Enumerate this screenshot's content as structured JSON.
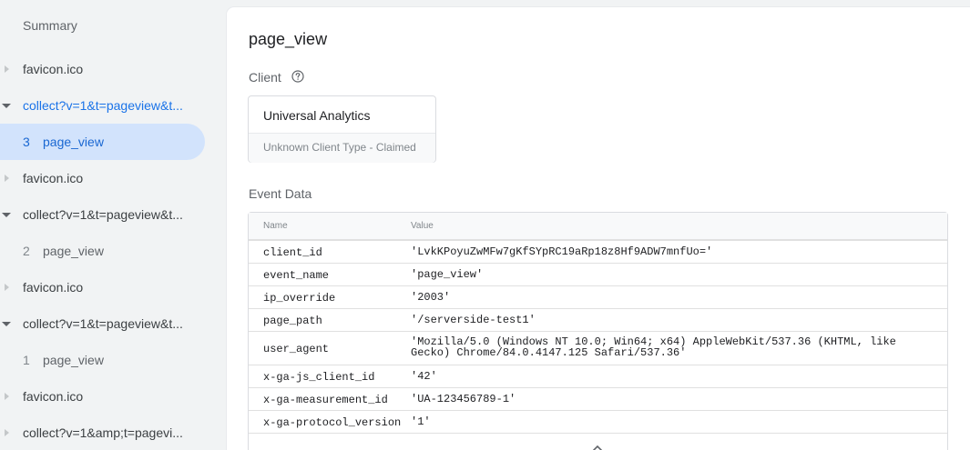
{
  "sidebar": {
    "items": [
      {
        "type": "summary",
        "label": "Summary"
      },
      {
        "type": "request",
        "label": "favicon.ico",
        "expanded": false
      },
      {
        "type": "request",
        "label": "collect?v=1&t=pageview&t...",
        "expanded": true,
        "active": true
      },
      {
        "type": "event",
        "num": "3",
        "label": "page_view",
        "selected": true
      },
      {
        "type": "request",
        "label": "favicon.ico",
        "expanded": false
      },
      {
        "type": "request",
        "label": "collect?v=1&t=pageview&t...",
        "expanded": true
      },
      {
        "type": "event",
        "num": "2",
        "label": "page_view"
      },
      {
        "type": "request",
        "label": "favicon.ico",
        "expanded": false
      },
      {
        "type": "request",
        "label": "collect?v=1&t=pageview&t...",
        "expanded": true
      },
      {
        "type": "event",
        "num": "1",
        "label": "page_view"
      },
      {
        "type": "request",
        "label": "favicon.ico",
        "expanded": false
      },
      {
        "type": "request",
        "label": "collect?v=1&amp;t=pagevi...",
        "expanded": false
      }
    ]
  },
  "main": {
    "title": "page_view",
    "client_label": "Client",
    "client": {
      "name": "Universal Analytics",
      "type": "Unknown Client Type - Claimed"
    },
    "event_data_label": "Event Data",
    "table": {
      "columns": [
        "Name",
        "Value"
      ],
      "rows": [
        {
          "name": "client_id",
          "value": "'LvkKPoyuZwMFw7gKfSYpRC19aRp18z8Hf9ADW7mnfUo='"
        },
        {
          "name": "event_name",
          "value": "'page_view'"
        },
        {
          "name": "ip_override",
          "value": "'2003'"
        },
        {
          "name": "page_path",
          "value": "'/serverside-test1'"
        },
        {
          "name": "user_agent",
          "value": "'Mozilla/5.0 (Windows NT 10.0; Win64; x64) AppleWebKit/537.36 (KHTML, like Gecko) Chrome/84.0.4147.125 Safari/537.36'"
        },
        {
          "name": "x-ga-js_client_id",
          "value": "'42'"
        },
        {
          "name": "x-ga-measurement_id",
          "value": "'UA-123456789-1'"
        },
        {
          "name": "x-ga-protocol_version",
          "value": "'1'"
        }
      ]
    }
  },
  "colors": {
    "accent": "#1a73e8",
    "selected_bg": "#d2e3fc",
    "sidebar_bg": "#f1f3f4"
  },
  "icons": {
    "help": "help-circle-icon",
    "expand": "chevron-up-icon"
  }
}
